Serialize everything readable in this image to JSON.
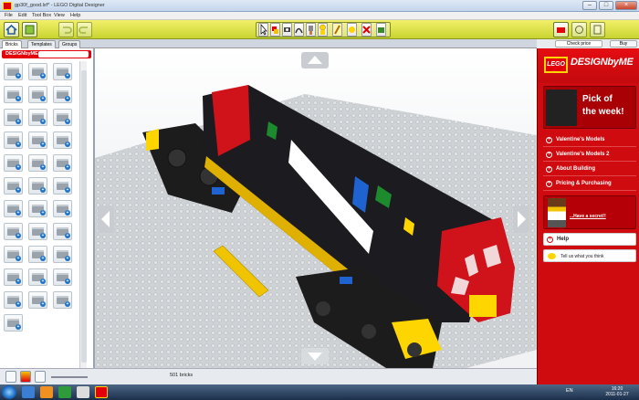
{
  "window": {
    "title": "gp30f_good.lxf* - LEGO Digital Designer",
    "controls": [
      "–",
      "□",
      "×"
    ]
  },
  "menu": [
    "File",
    "Edit",
    "Tool Box",
    "View",
    "Help"
  ],
  "toolbar": {
    "left_buttons": [
      "home-icon",
      "new-icon"
    ],
    "tools": [
      "select-icon",
      "clone-icon",
      "hinge-icon",
      "flex-icon",
      "paint-icon",
      "hide-icon",
      "delete-icon",
      "minifig-icon"
    ],
    "right_buttons": [
      "mode-build-icon",
      "mode-view-icon",
      "mode-instructions-icon"
    ]
  },
  "tabs": {
    "left": [
      "Bricks",
      "Templates",
      "Groups"
    ],
    "right": [
      "Check price",
      "Buy"
    ]
  },
  "left_panel": {
    "header": "DESIGNbyME"
  },
  "status": {
    "brick_count": "501 bricks"
  },
  "right_panel": {
    "brand_logo": "LEGO",
    "brand_title": "DESIGNbyME",
    "pick_line1": "Pick of",
    "pick_line2": "the week!",
    "links": [
      "Valentine's Models",
      "Valentine's Models 2",
      "About Building",
      "Pricing & Purchasing"
    ],
    "secret": "...Have a secret!!",
    "help": "Help",
    "tell_us": "Tell us what you think"
  },
  "taskbar": {
    "lang": "EN",
    "time": "16:20",
    "date": "2011-01-27"
  },
  "colors": {
    "accent_red": "#cf0b10",
    "toolbar_yellow": "#d8de3c",
    "lego_yellow": "#ffd500"
  }
}
